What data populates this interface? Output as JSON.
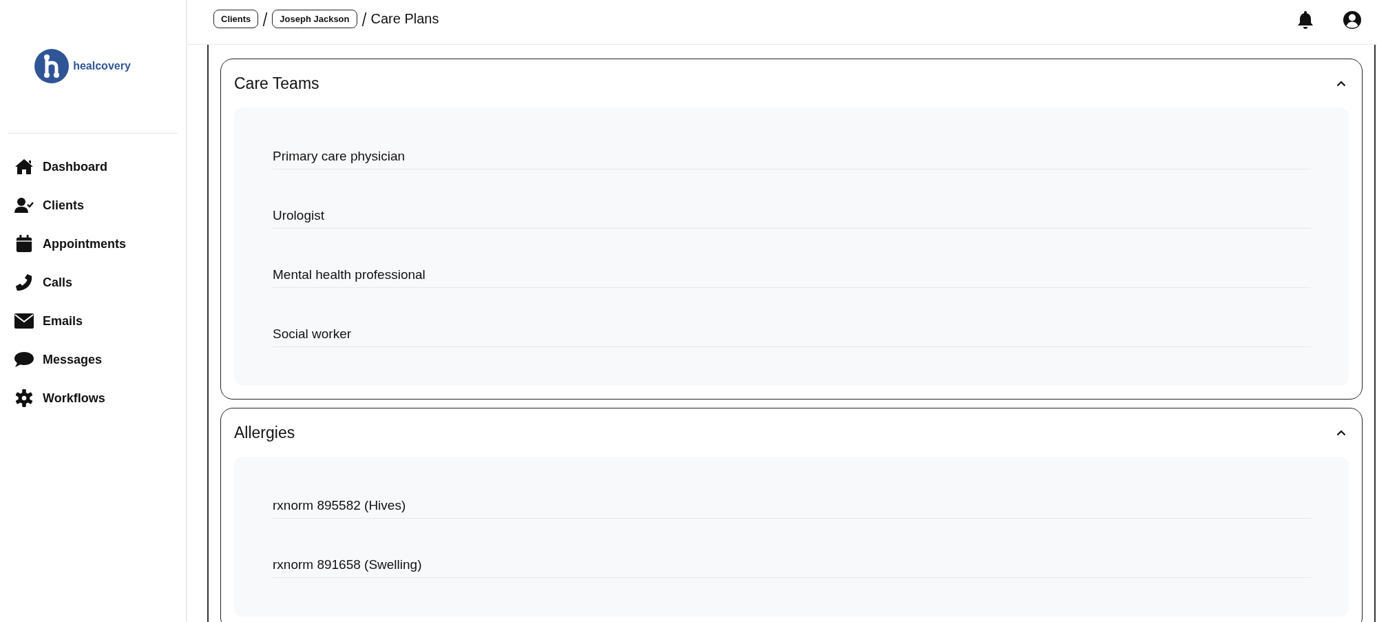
{
  "logo": {
    "name": "healcovery"
  },
  "sidebar": {
    "items": [
      {
        "label": "Dashboard"
      },
      {
        "label": "Clients"
      },
      {
        "label": "Appointments"
      },
      {
        "label": "Calls"
      },
      {
        "label": "Emails"
      },
      {
        "label": "Messages"
      },
      {
        "label": "Workflows"
      }
    ]
  },
  "breadcrumb": {
    "links": [
      "Clients",
      "Joseph Jackson"
    ],
    "current": "Care Plans"
  },
  "sections": [
    {
      "title": "Care Teams",
      "expanded": true,
      "items": [
        "Primary care physician",
        "Urologist",
        "Mental health professional",
        "Social worker"
      ]
    },
    {
      "title": "Allergies",
      "expanded": true,
      "items": [
        "rxnorm 895582 (Hives)",
        "rxnorm 891658 (Swelling)"
      ]
    }
  ]
}
